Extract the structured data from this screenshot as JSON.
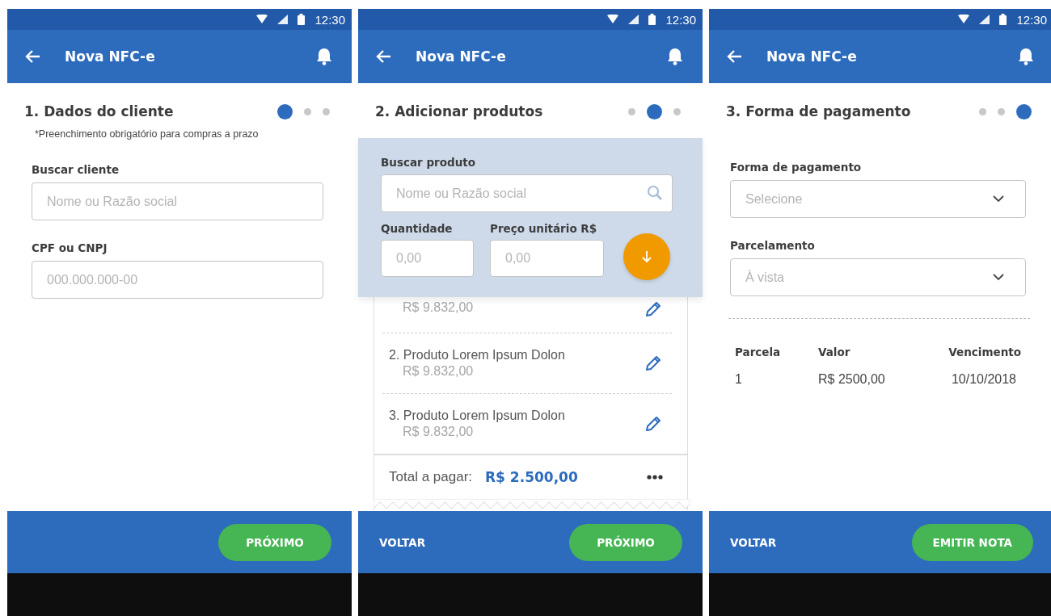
{
  "phones": [
    {
      "kind": "client",
      "status_time": "12:30",
      "title": "Nova NFC-e",
      "heading": "1. Dados do cliente",
      "note": "*Preenchimento obrigatório para compras a prazo",
      "dots": [
        {
          "selected": true
        },
        {
          "selected": false
        },
        {
          "selected": false
        }
      ],
      "fields": [
        {
          "label": "Buscar cliente",
          "placeholder": "Nome ou Razão social"
        },
        {
          "label": "CPF ou CNPJ",
          "placeholder": "000.000.000-00"
        }
      ],
      "footer": {
        "primary": "PRÓXIMO"
      }
    },
    {
      "kind": "products",
      "status_time": "12:30",
      "title": "Nova NFC-e",
      "heading": "2. Adicionar produtos",
      "dots": [
        {
          "selected": false
        },
        {
          "selected": true
        },
        {
          "selected": false
        }
      ],
      "search": {
        "label": "Buscar produto",
        "placeholder": "Nome ou Razão social"
      },
      "quantity": {
        "label": "Quantidade",
        "placeholder": "0,00"
      },
      "price": {
        "label": "Preço unitário R$",
        "placeholder": "0,00"
      },
      "items": [
        {
          "price": "R$ 9.832,00"
        },
        {
          "name": "2. Produto Lorem Ipsum Dolon",
          "price": "R$ 9.832,00"
        },
        {
          "name": "3. Produto Lorem Ipsum Dolon",
          "price": "R$ 9.832,00"
        }
      ],
      "total": {
        "label": "Total a pagar:",
        "value": "R$ 2.500,00"
      },
      "footer": {
        "back": "VOLTAR",
        "primary": "PRÓXIMO"
      }
    },
    {
      "kind": "payment",
      "status_time": "12:30",
      "title": "Nova NFC-e",
      "heading": "3. Forma de pagamento",
      "dots": [
        {
          "selected": false
        },
        {
          "selected": false
        },
        {
          "selected": true
        }
      ],
      "selects": [
        {
          "label": "Forma de pagamento",
          "placeholder": "Selecione"
        },
        {
          "label": "Parcelamento",
          "placeholder": "À vista"
        }
      ],
      "table": {
        "columns": [
          "Parcela",
          "Valor",
          "Vencimento"
        ],
        "rows": [
          [
            "1",
            "R$ 2500,00",
            "10/10/2018"
          ]
        ]
      },
      "footer": {
        "back": "VOLTAR",
        "primary": "EMITIR NOTA"
      }
    }
  ]
}
